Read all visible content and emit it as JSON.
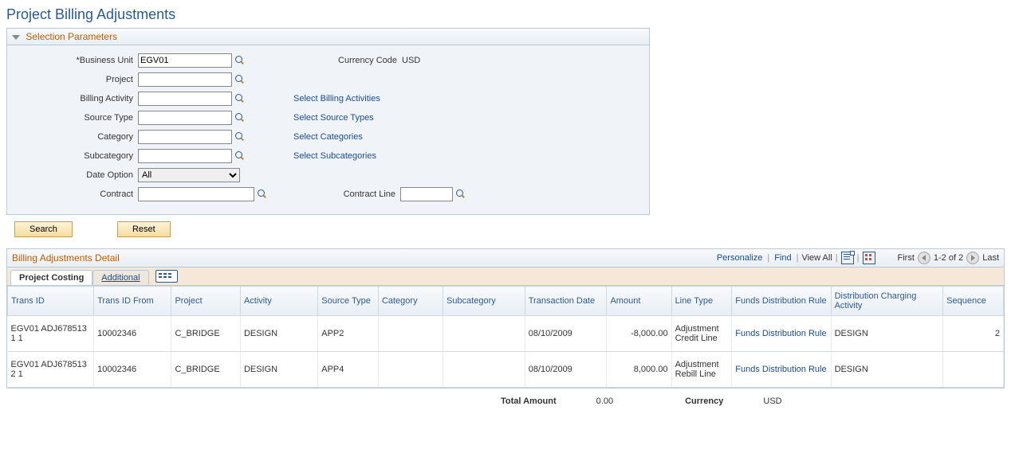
{
  "page_title": "Project Billing Adjustments",
  "section_title": "Selection Parameters",
  "labels": {
    "business_unit": "*Business Unit",
    "currency_code": "Currency Code",
    "project": "Project",
    "billing_activity": "Billing Activity",
    "source_type": "Source Type",
    "category": "Category",
    "subcategory": "Subcategory",
    "date_option": "Date Option",
    "contract": "Contract",
    "contract_line": "Contract Line"
  },
  "values": {
    "business_unit": "EGV01",
    "currency_code": "USD",
    "project": "",
    "billing_activity": "",
    "source_type": "",
    "category": "",
    "subcategory": "",
    "date_option": "All",
    "contract": "",
    "contract_line": ""
  },
  "links": {
    "billing_activities": "Select Billing Activities",
    "source_types": "Select Source Types",
    "categories": "Select Categories",
    "subcategories": "Select Subcategories"
  },
  "buttons": {
    "search": "Search",
    "reset": "Reset"
  },
  "grid": {
    "title": "Billing Adjustments Detail",
    "toolbar": {
      "personalize": "Personalize",
      "find": "Find",
      "view_all": "View All",
      "first": "First",
      "range": "1-2 of 2",
      "last": "Last"
    },
    "tabs": {
      "project_costing": "Project Costing",
      "additional": "Additional"
    },
    "columns": {
      "trans_id": "Trans ID",
      "trans_id_from": "Trans ID From",
      "project": "Project",
      "activity": "Activity",
      "source_type": "Source Type",
      "category": "Category",
      "subcategory": "Subcategory",
      "trans_date": "Transaction Date",
      "amount": "Amount",
      "line_type": "Line Type",
      "fdr": "Funds Distribution Rule",
      "dca": "Distribution Charging Activity",
      "sequence": "Sequence"
    },
    "rows": [
      {
        "trans_id": "EGV01 ADJ678513 1 1",
        "trans_id_from": "10002346",
        "project": "C_BRIDGE",
        "activity": "DESIGN",
        "source_type": "APP2",
        "category": "",
        "subcategory": "",
        "trans_date": "08/10/2009",
        "amount": "-8,000.00",
        "line_type": "Adjustment Credit Line",
        "fdr": "Funds Distribution Rule",
        "dca": "DESIGN",
        "sequence": "2"
      },
      {
        "trans_id": "EGV01 ADJ678513 2 1",
        "trans_id_from": "10002346",
        "project": "C_BRIDGE",
        "activity": "DESIGN",
        "source_type": "APP4",
        "category": "",
        "subcategory": "",
        "trans_date": "08/10/2009",
        "amount": "8,000.00",
        "line_type": "Adjustment Rebill Line",
        "fdr": "Funds Distribution Rule",
        "dca": "DESIGN",
        "sequence": ""
      }
    ]
  },
  "totals": {
    "total_amount_lbl": "Total Amount",
    "total_amount_val": "0.00",
    "currency_lbl": "Currency",
    "currency_val": "USD"
  }
}
